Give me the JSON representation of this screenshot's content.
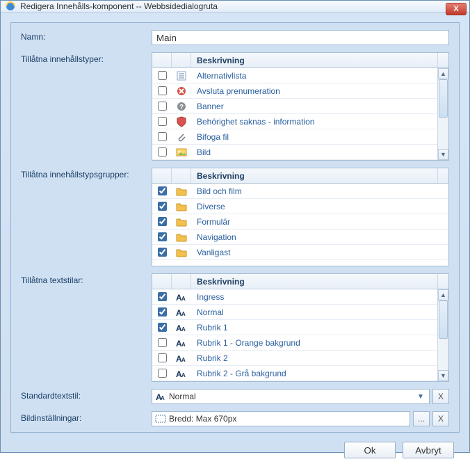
{
  "window": {
    "title": "Redigera Innehålls-komponent -- Webbsidedialogruta",
    "close": "X"
  },
  "labels": {
    "name": "Namn:",
    "allowed_types": "Tillåtna innehållstyper:",
    "allowed_groups": "Tillåtna innehållstypsgrupper:",
    "allowed_styles": "Tillåtna textstilar:",
    "default_style": "Standardtextstil:",
    "image_settings": "Bildinställningar:"
  },
  "name_value": "Main",
  "grid_header": "Beskrivning",
  "content_types": [
    {
      "checked": false,
      "icon": "list",
      "label": "Alternativlista"
    },
    {
      "checked": false,
      "icon": "cancel",
      "label": "Avsluta prenumeration"
    },
    {
      "checked": false,
      "icon": "help",
      "label": "Banner"
    },
    {
      "checked": false,
      "icon": "shield",
      "label": "Behörighet saknas - information"
    },
    {
      "checked": false,
      "icon": "clip",
      "label": "Bifoga fil"
    },
    {
      "checked": false,
      "icon": "image",
      "label": "Bild"
    }
  ],
  "content_groups": [
    {
      "checked": true,
      "icon": "folder",
      "label": "Bild och film"
    },
    {
      "checked": true,
      "icon": "folder",
      "label": "Diverse"
    },
    {
      "checked": true,
      "icon": "folder",
      "label": "Formulär"
    },
    {
      "checked": true,
      "icon": "folder",
      "label": "Navigation"
    },
    {
      "checked": true,
      "icon": "folder",
      "label": "Vanligast"
    }
  ],
  "text_styles": [
    {
      "checked": true,
      "icon": "aA",
      "label": "Ingress"
    },
    {
      "checked": true,
      "icon": "aA",
      "label": "Normal"
    },
    {
      "checked": true,
      "icon": "aA",
      "label": "Rubrik 1"
    },
    {
      "checked": false,
      "icon": "aA",
      "label": "Rubrik 1 - Orange bakgrund"
    },
    {
      "checked": false,
      "icon": "aA",
      "label": "Rubrik 2"
    },
    {
      "checked": false,
      "icon": "aA",
      "label": "Rubrik 2 - Grå bakgrund"
    }
  ],
  "default_style": {
    "icon": "aA",
    "value": "Normal",
    "clear": "X"
  },
  "image_settings": {
    "icon": "dims",
    "value": "Bredd: Max 670px",
    "browse": "...",
    "clear": "X"
  },
  "buttons": {
    "ok": "Ok",
    "cancel": "Avbryt"
  }
}
